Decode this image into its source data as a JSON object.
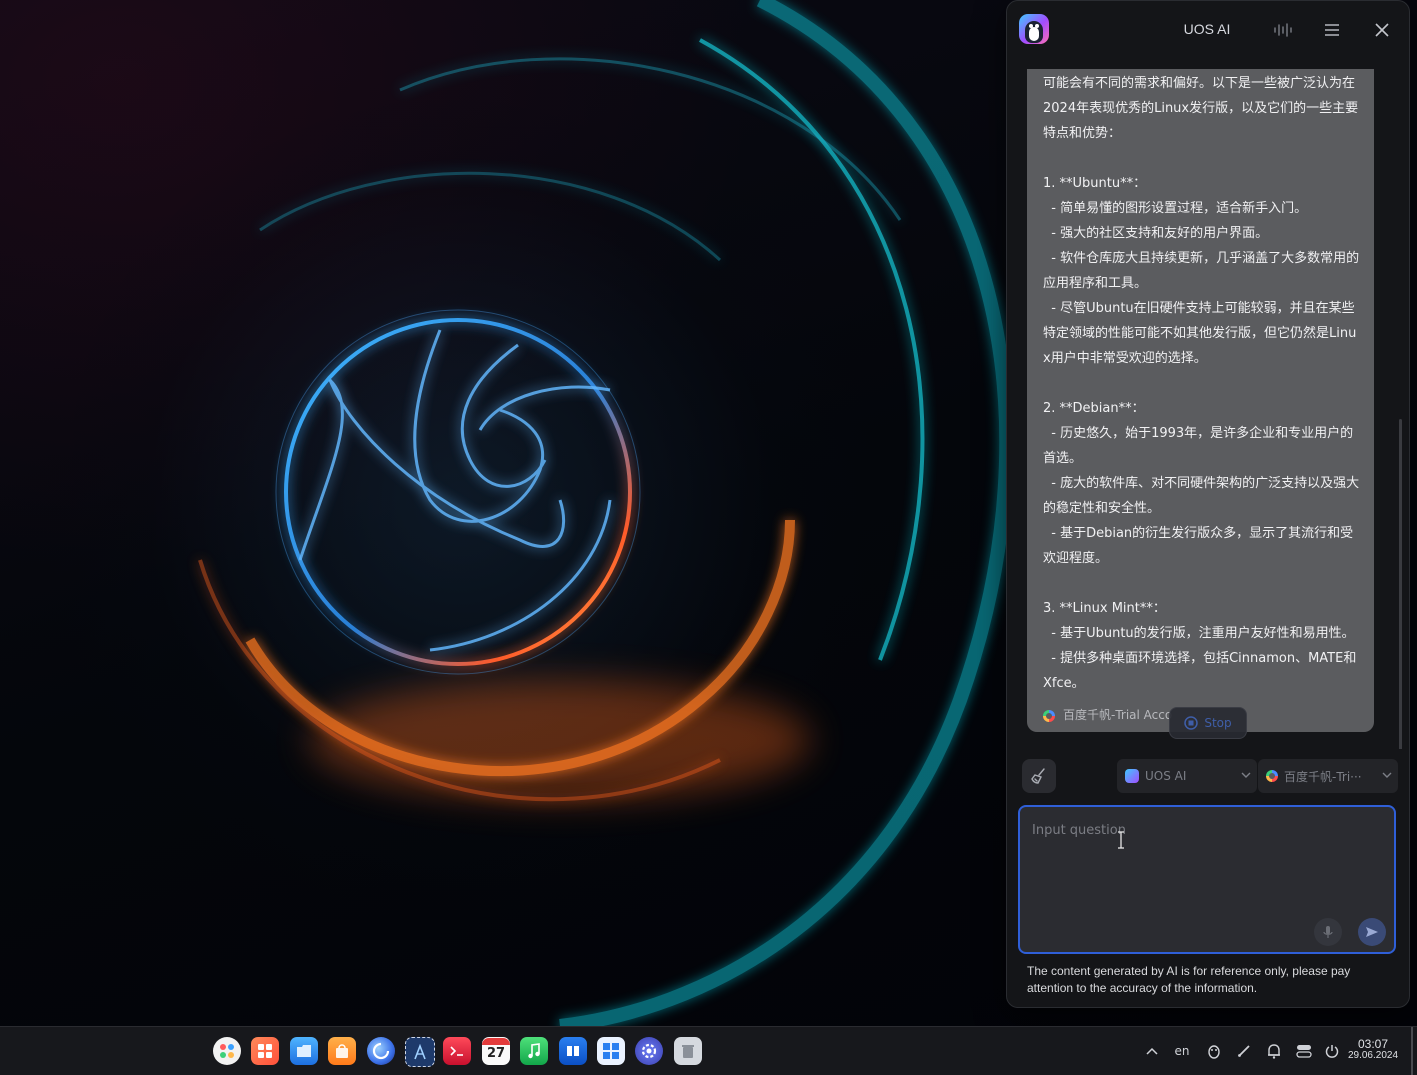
{
  "window": {
    "title": "UOS AI"
  },
  "chat": {
    "answer_text": "可能会有不同的需求和偏好。以下是一些被广泛认为在2024年表现优秀的Linux发行版，以及它们的一些主要特点和优势：\n\n1. **Ubuntu**：\n  - 简单易懂的图形设置过程，适合新手入门。\n  - 强大的社区支持和友好的用户界面。\n  - 软件仓库庞大且持续更新，几乎涵盖了大多数常用的应用程序和工具。\n  - 尽管Ubuntu在旧硬件支持上可能较弱，并且在某些特定领域的性能可能不如其他发行版，但它仍然是Linux用户中非常受欢迎的选择。\n\n2. **Debian**：\n  - 历史悠久，始于1993年，是许多企业和专业用户的首选。\n  - 庞大的软件库、对不同硬件架构的广泛支持以及强大的稳定性和安全性。\n  - 基于Debian的衍生发行版众多，显示了其流行和受欢迎程度。\n\n3. **Linux Mint**：\n  - 基于Ubuntu的发行版，注重用户友好性和易用性。\n  - 提供多种桌面环境选择，包括Cinnamon、MATE和Xfce。",
    "source_label": "百度千帆-Trial Acco",
    "stop_label": "Stop"
  },
  "controls": {
    "assistant_label": "UOS AI",
    "model_label": "百度千帆-Tri···"
  },
  "input": {
    "placeholder": "Input question"
  },
  "disclaimer": "The content generated by AI is for reference only, please pay attention to the accuracy of the information.",
  "tray": {
    "language": "en"
  },
  "clock": {
    "time": "03:07",
    "date": "29.06.2024"
  },
  "calendar_day": "27",
  "colors": {
    "accent": "#2f5fd8",
    "panel_bg": "#141518",
    "bubble_bg": "#5b5c5f"
  }
}
